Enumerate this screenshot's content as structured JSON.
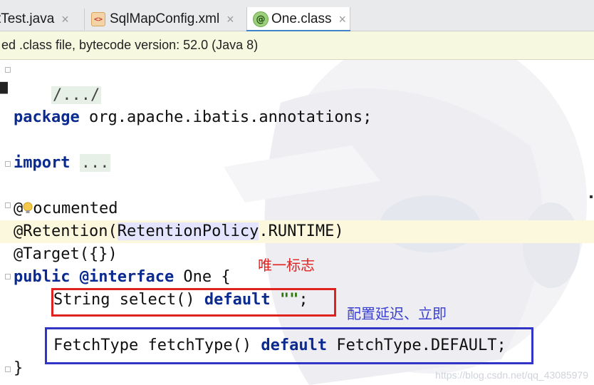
{
  "tabs": [
    {
      "label": "Test.java",
      "visible_prefix": "t",
      "active": false
    },
    {
      "label": "SqlMapConfig.xml",
      "icon": "xml-file-icon",
      "active": false
    },
    {
      "label": "One.class",
      "icon": "annotation-class-icon",
      "active": true
    }
  ],
  "tab_close_glyph": "×",
  "banner": {
    "text": "ed .class file, bytecode version: 52.0 (Java 8)"
  },
  "code": {
    "header_fold": "/.../",
    "package_kw": "package",
    "package_name": " org.apache.ibatis.annotations;",
    "import_kw": "import",
    "import_collapsed": "...",
    "line_documented_at": "@",
    "line_documented_rest": "ocumented",
    "line_retention_pre": "@Retention(",
    "line_retention_word": "RetentionPolicy",
    "line_retention_post": ".RUNTIME)",
    "line_target": "@Target({})",
    "public_kw": "public",
    "interface_kw": "@interface",
    "interface_name": " One {",
    "select_type": "String select() ",
    "default_kw": "default",
    "select_value": "\"\"",
    "select_end": ";",
    "fetch_sig": "FetchType fetchType() ",
    "fetch_value": " FetchType.DEFAULT;",
    "closing": "}"
  },
  "annotations": {
    "red_note": "唯一标志",
    "blue_note": "配置延迟、立即"
  },
  "watermark": "https://blog.csdn.net/qq_43085979",
  "colors": {
    "keyword": "#0b2a8f",
    "string": "#2c7a0b",
    "red_box": "#e0221f",
    "blue_box": "#3234c5",
    "banner_bg": "#f7f8e0"
  }
}
